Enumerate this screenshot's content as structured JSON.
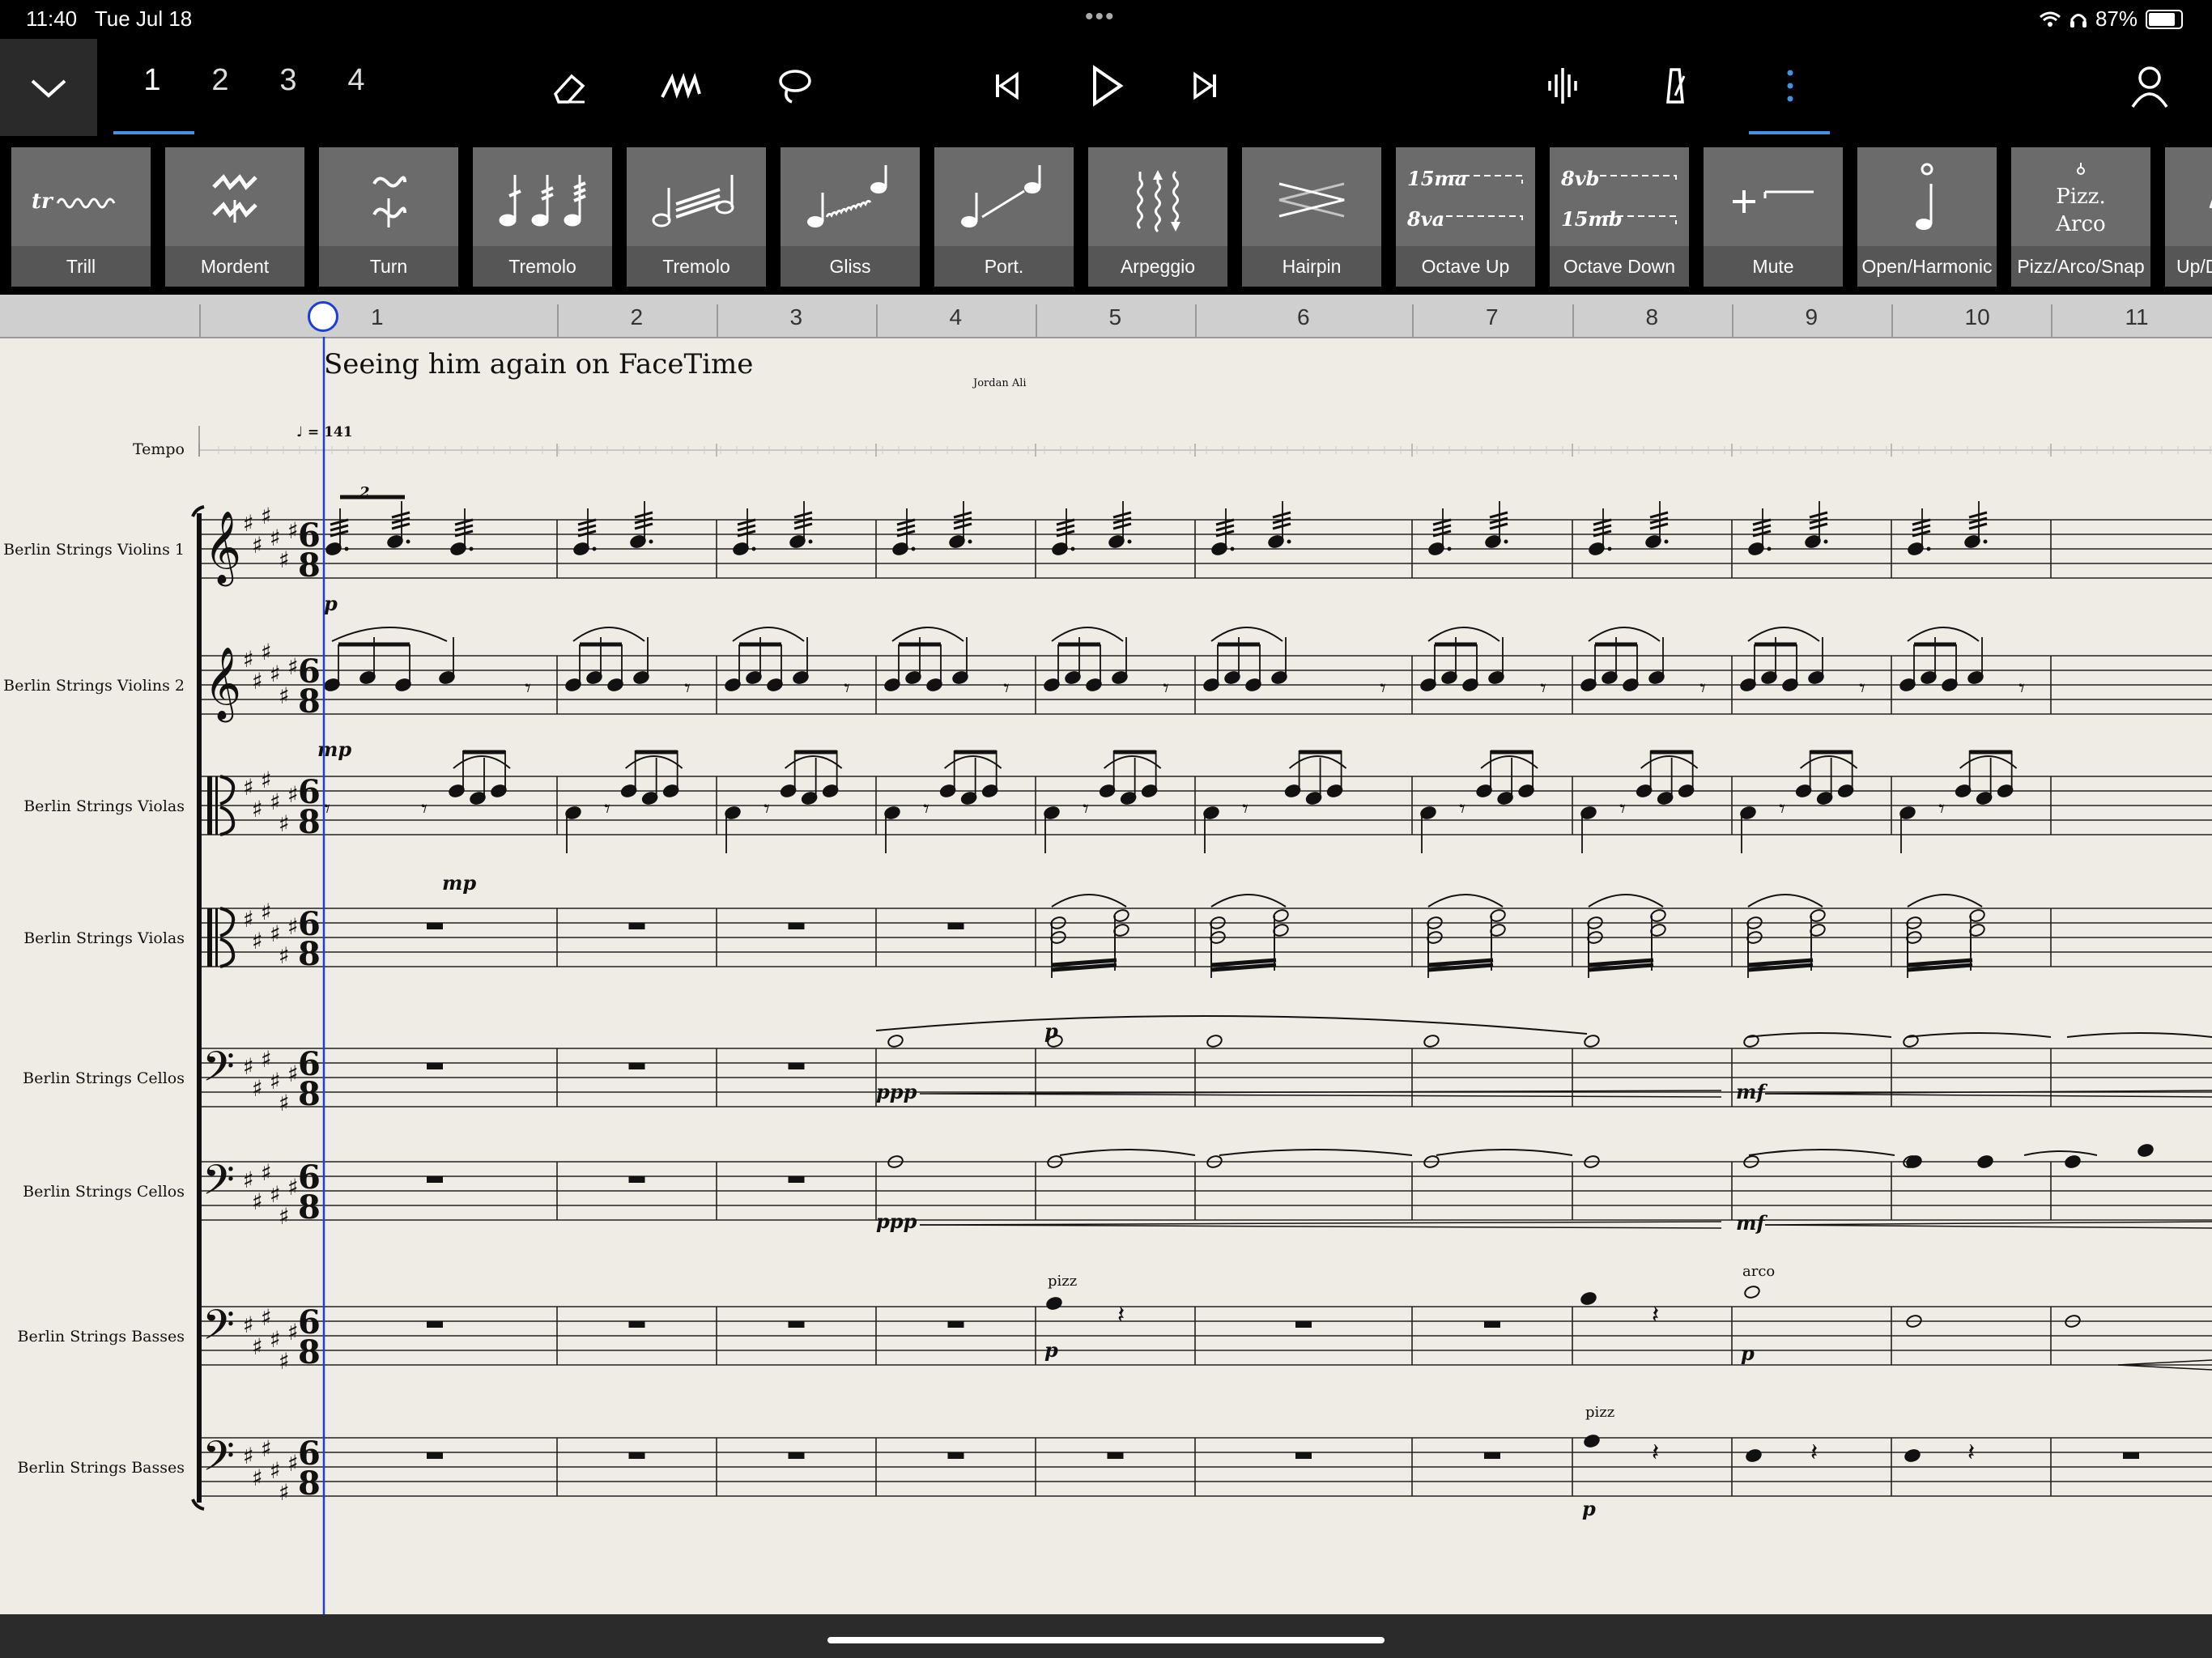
{
  "status_bar": {
    "time": "11:40",
    "date": "Tue Jul 18",
    "battery": "87%"
  },
  "toolbar": {
    "voices": [
      "1",
      "2",
      "3",
      "4"
    ],
    "active_voice": "1",
    "icons": [
      "eraser-icon",
      "pen-scribble-icon",
      "lasso-icon",
      "skip-back-icon",
      "play-icon",
      "skip-forward-icon",
      "waveform-icon",
      "metronome-icon",
      "more-vertical-icon",
      "account-icon"
    ]
  },
  "palette": [
    {
      "label": "Trill"
    },
    {
      "label": "Mordent"
    },
    {
      "label": "Turn"
    },
    {
      "label": "Tremolo"
    },
    {
      "label": "Tremolo"
    },
    {
      "label": "Gliss"
    },
    {
      "label": "Port."
    },
    {
      "label": "Arpeggio"
    },
    {
      "label": "Hairpin"
    },
    {
      "label": "Octave Up"
    },
    {
      "label": "Octave Down"
    },
    {
      "label": "Mute"
    },
    {
      "label": "Open/Harmonic"
    },
    {
      "label": "Pizz/Arco/Snap"
    },
    {
      "label": "Up/Do"
    }
  ],
  "palette_glyphs": {
    "trill": "tr",
    "octave_up_top": "15ma",
    "octave_up_bottom": "8va",
    "octave_down_top": "8vb",
    "octave_down_bottom": "15mb",
    "pizz": "Pizz.",
    "arco": "Arco"
  },
  "ruler": {
    "measures": [
      "1",
      "2",
      "3",
      "4",
      "5",
      "6",
      "7",
      "8",
      "9",
      "10",
      "11"
    ]
  },
  "score": {
    "title": "Seeing him again on FaceTime",
    "composer": "Jordan Ali",
    "tempo_label": "Tempo",
    "tempo_marking": "♩ = 141",
    "time_signature": "6/8",
    "tuplet": "2",
    "instruments": [
      "Berlin Strings Violins 1",
      "Berlin Strings Violins 2",
      "Berlin Strings Violas",
      "Berlin Strings Violas",
      "Berlin Strings Cellos",
      "Berlin Strings Cellos",
      "Berlin Strings Basses",
      "Berlin Strings Basses"
    ],
    "dynamics": {
      "vln1_m1": "p",
      "vln2_m1": "mp",
      "vla1_m1": "mp",
      "vla2_m5": "p",
      "vc1_m4": "ppp",
      "vc1_m9": "mf",
      "vc2_m4": "ppp",
      "vc2_m9": "mf",
      "cb1_m5": "p",
      "cb1_m9": "p",
      "cb2_m8": "p"
    },
    "techniques": {
      "cb1_m5": "pizz",
      "cb1_m9": "arco",
      "cb2_m8": "pizz"
    }
  }
}
